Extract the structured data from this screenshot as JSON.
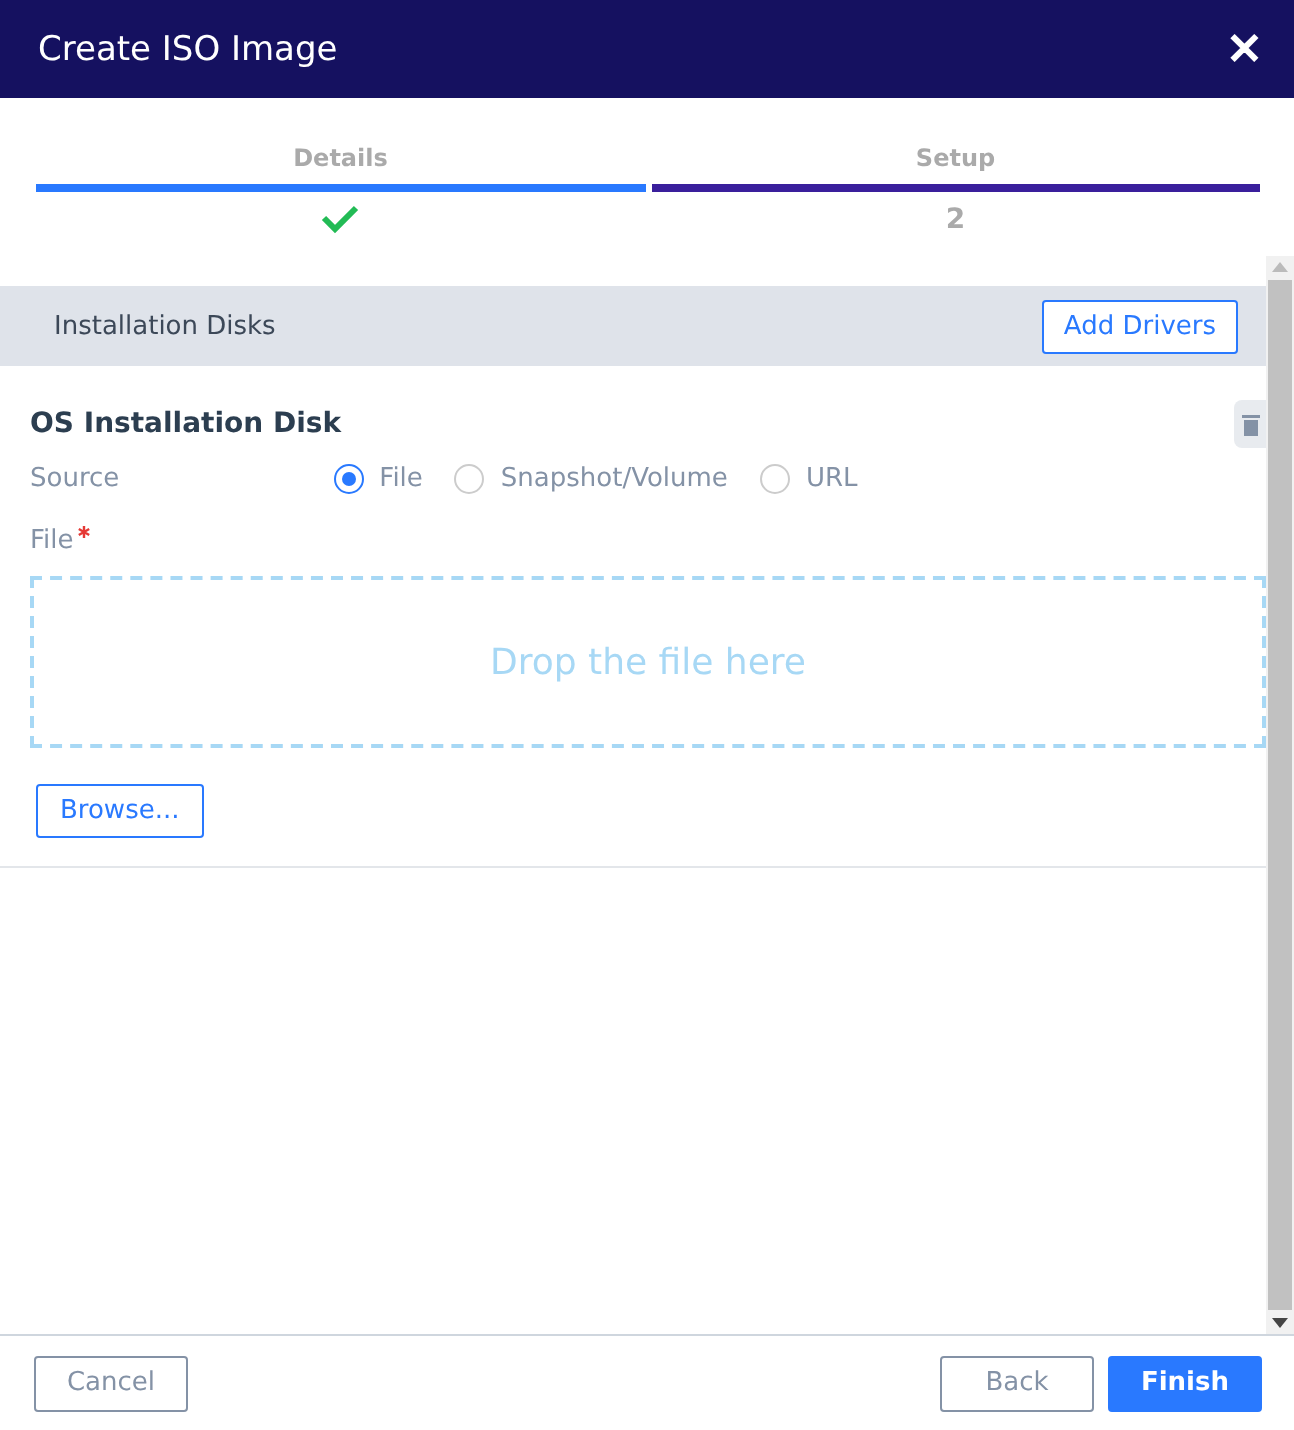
{
  "window": {
    "title": "Create ISO Image",
    "close": "✕"
  },
  "steps": [
    {
      "label": "Details",
      "done": true
    },
    {
      "label": "Setup",
      "done": false,
      "number": "2"
    }
  ],
  "section": {
    "title": "Installation Disks",
    "button": "Add Drivers"
  },
  "disk": {
    "title": "OS Installation Disk",
    "source_label": "Source",
    "sources": [
      {
        "label": "File",
        "selected": true
      },
      {
        "label": "Snapshot/Volume",
        "selected": false
      },
      {
        "label": "URL",
        "selected": false
      }
    ],
    "file_label": "File",
    "required": true,
    "drop_text": "Drop the file here",
    "browse": "Browse..."
  },
  "footer": {
    "cancel": "Cancel",
    "back": "Back",
    "finish": "Finish"
  }
}
